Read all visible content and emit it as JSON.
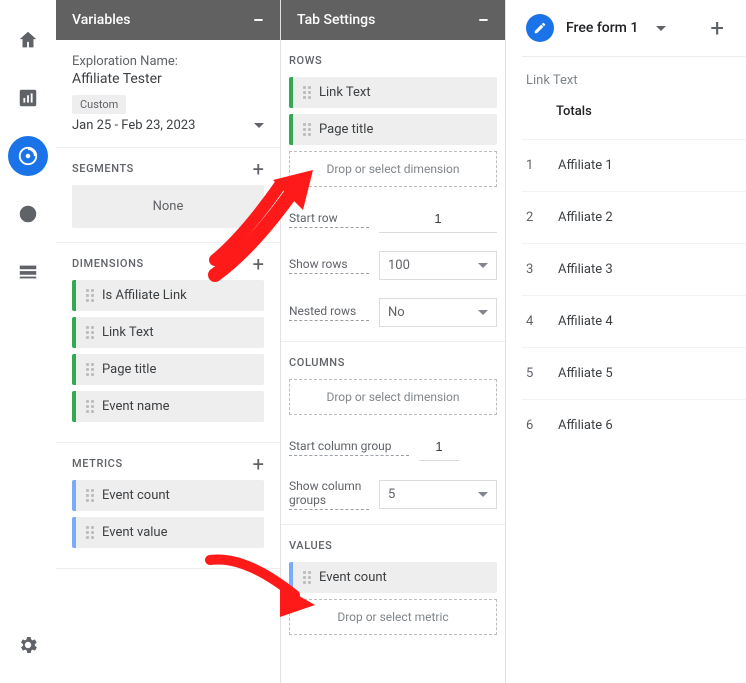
{
  "panels": {
    "variables": "Variables",
    "tab_settings": "Tab Settings"
  },
  "exploration": {
    "label": "Exploration Name:",
    "value": "Affiliate Tester",
    "range_chip": "Custom",
    "date_range": "Jan 25 - Feb 23, 2023"
  },
  "segments": {
    "heading": "SEGMENTS",
    "none": "None"
  },
  "dimensions": {
    "heading": "DIMENSIONS",
    "items": [
      "Is Affiliate Link",
      "Link Text",
      "Page title",
      "Event name"
    ]
  },
  "metrics": {
    "heading": "METRICS",
    "items": [
      "Event count",
      "Event value"
    ]
  },
  "rows": {
    "heading": "ROWS",
    "items": [
      "Link Text",
      "Page title"
    ],
    "drop": "Drop or select dimension",
    "start_row_label": "Start row",
    "start_row_value": "1",
    "show_rows_label": "Show rows",
    "show_rows_value": "100",
    "nested_label": "Nested rows",
    "nested_value": "No"
  },
  "columns": {
    "heading": "COLUMNS",
    "drop": "Drop or select dimension",
    "start_group_label": "Start column group",
    "start_group_value": "1",
    "show_groups_label": "Show column groups",
    "show_groups_value": "5"
  },
  "values": {
    "heading": "VALUES",
    "items": [
      "Event count"
    ],
    "drop": "Drop or select metric"
  },
  "report": {
    "title": "Free form 1",
    "column_header": "Link Text",
    "totals": "Totals",
    "rows": [
      {
        "idx": "1",
        "label": "Affiliate 1"
      },
      {
        "idx": "2",
        "label": "Affiliate 2"
      },
      {
        "idx": "3",
        "label": "Affiliate 3"
      },
      {
        "idx": "4",
        "label": "Affiliate 4"
      },
      {
        "idx": "5",
        "label": "Affiliate 5"
      },
      {
        "idx": "6",
        "label": "Affiliate 6"
      }
    ]
  }
}
